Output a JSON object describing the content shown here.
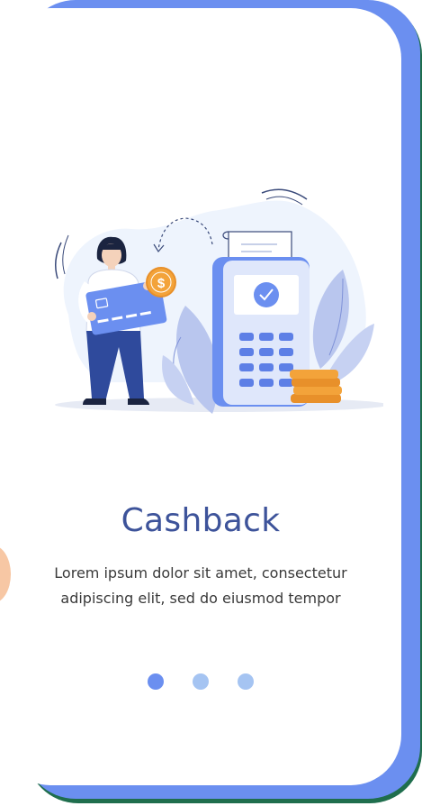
{
  "onboarding": {
    "title": "Cashback",
    "description_line1": "Lorem ipsum dolor sit amet, consectetur",
    "description_line2": "adipiscing elit, sed do eiusmod tempor",
    "page_count": 3,
    "active_index": 0
  },
  "colors": {
    "accent": "#6b8ff0",
    "title": "#3d539a",
    "dot_inactive": "#a5c4f2",
    "frame_shadow": "#1f6e4d",
    "coin": "#f3a33a"
  },
  "icons": {
    "illustration": "cashback-payment-illustration",
    "check": "check-icon",
    "dollar": "dollar-coin-icon"
  }
}
